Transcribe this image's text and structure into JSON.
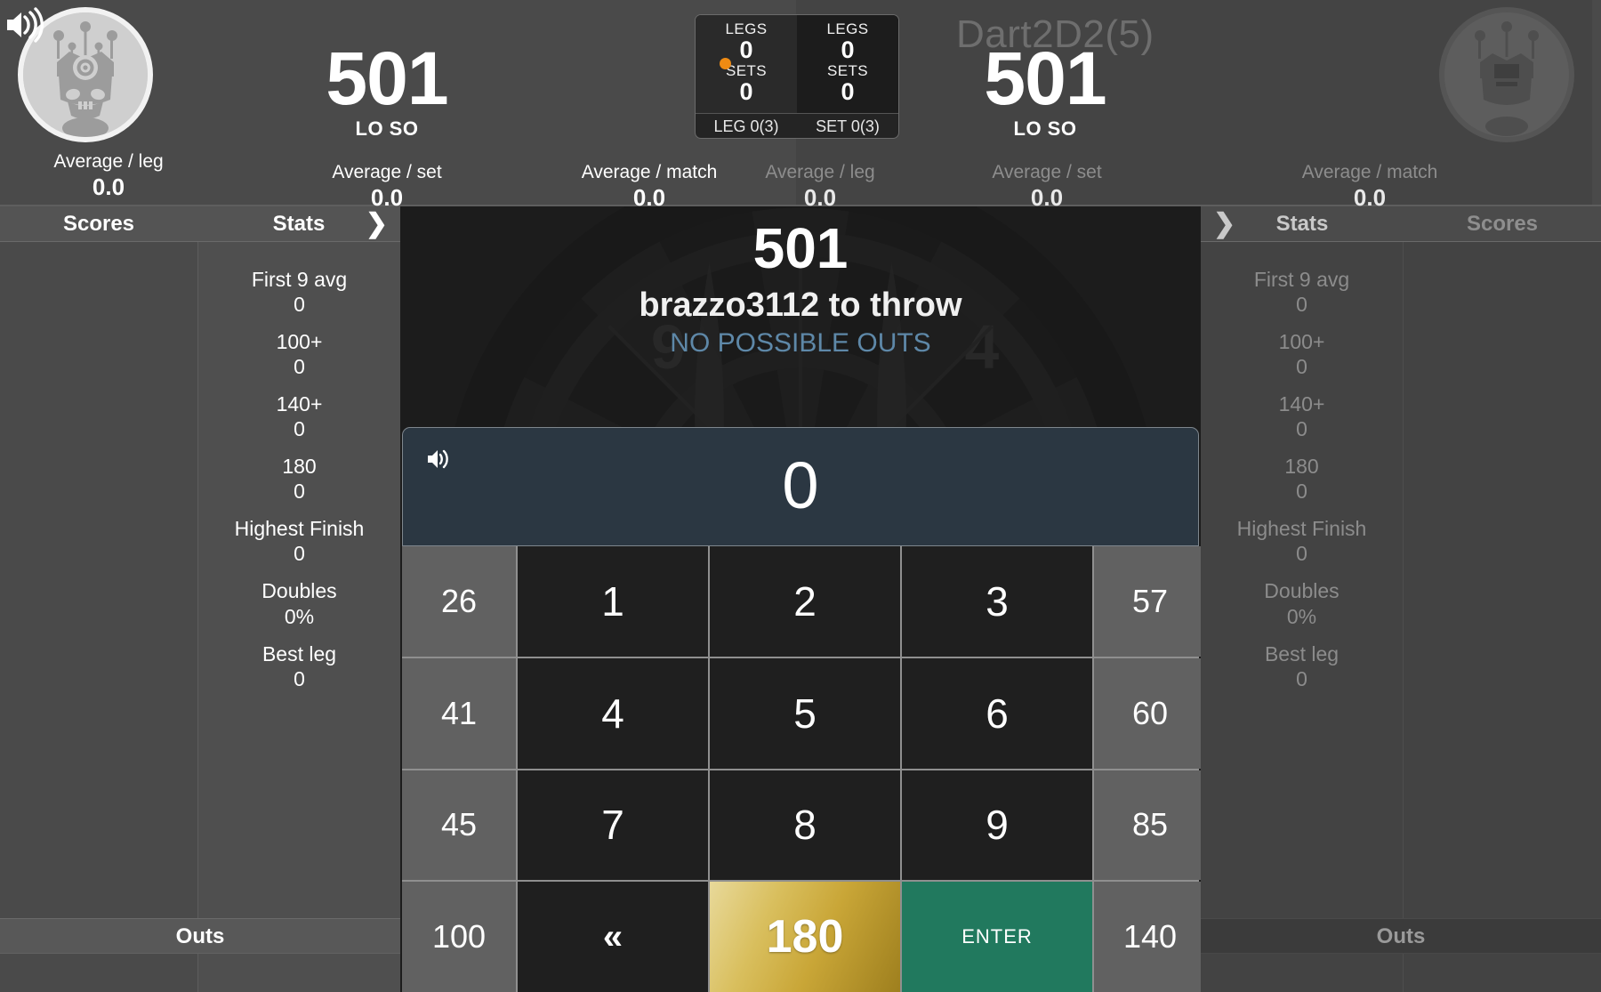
{
  "players": {
    "left": {
      "name": "",
      "score": "501",
      "mode": "LO SO",
      "avg_leg_label": "Average / leg",
      "avg_leg_value": "0.0",
      "avg_set_label": "Average / set",
      "avg_set_value": "0.0",
      "avg_match_label": "Average / match",
      "avg_match_value": "0.0"
    },
    "right": {
      "name": "Dart2D2(5)",
      "score": "501",
      "mode": "LO SO",
      "avg_leg_label": "Average / leg",
      "avg_leg_value": "0.0",
      "avg_set_label": "Average / set",
      "avg_set_value": "0.0",
      "avg_match_label": "Average / match",
      "avg_match_value": "0.0"
    }
  },
  "legsets": {
    "left": {
      "legs_label": "LEGS",
      "legs_value": "0",
      "sets_label": "SETS",
      "sets_value": "0"
    },
    "right": {
      "legs_label": "LEGS",
      "legs_value": "0",
      "sets_label": "SETS",
      "sets_value": "0"
    },
    "leg_footer": "LEG 0(3)",
    "set_footer": "SET 0(3)",
    "active_turn_color": "#ef8b13"
  },
  "tabs": {
    "scores_label": "Scores",
    "stats_label": "Stats",
    "chevron": "❯"
  },
  "stats": [
    {
      "label": "First 9 avg",
      "value": "0"
    },
    {
      "label": "100+",
      "value": "0"
    },
    {
      "label": "140+",
      "value": "0"
    },
    {
      "label": "180",
      "value": "0"
    },
    {
      "label": "Highest Finish",
      "value": "0"
    },
    {
      "label": "Doubles",
      "value": "0%"
    },
    {
      "label": "Best leg",
      "value": "0"
    }
  ],
  "outs_label": "Outs",
  "center": {
    "score": "501",
    "turn_text": "brazzo3112 to throw",
    "outs_text": "NO POSSIBLE OUTS",
    "outs_color": "#5e88a8"
  },
  "input": {
    "value": "0",
    "speaker_icon": "speaker-icon"
  },
  "keypad": {
    "rows": [
      [
        {
          "label": "26",
          "kind": "side"
        },
        {
          "label": "1",
          "kind": "num"
        },
        {
          "label": "2",
          "kind": "num"
        },
        {
          "label": "3",
          "kind": "num"
        },
        {
          "label": "57",
          "kind": "side"
        }
      ],
      [
        {
          "label": "41",
          "kind": "side"
        },
        {
          "label": "4",
          "kind": "num"
        },
        {
          "label": "5",
          "kind": "num"
        },
        {
          "label": "6",
          "kind": "num"
        },
        {
          "label": "60",
          "kind": "side"
        }
      ],
      [
        {
          "label": "45",
          "kind": "side"
        },
        {
          "label": "7",
          "kind": "num"
        },
        {
          "label": "8",
          "kind": "num"
        },
        {
          "label": "9",
          "kind": "num"
        },
        {
          "label": "85",
          "kind": "side"
        }
      ],
      [
        {
          "label": "100",
          "kind": "side"
        },
        {
          "label": "«",
          "kind": "back"
        },
        {
          "label": "180",
          "kind": "gold"
        },
        {
          "label": "ENTER",
          "kind": "enter"
        },
        {
          "label": "140",
          "kind": "side"
        }
      ]
    ],
    "gold_color": "#c9a637",
    "enter_color": "#21795e"
  }
}
